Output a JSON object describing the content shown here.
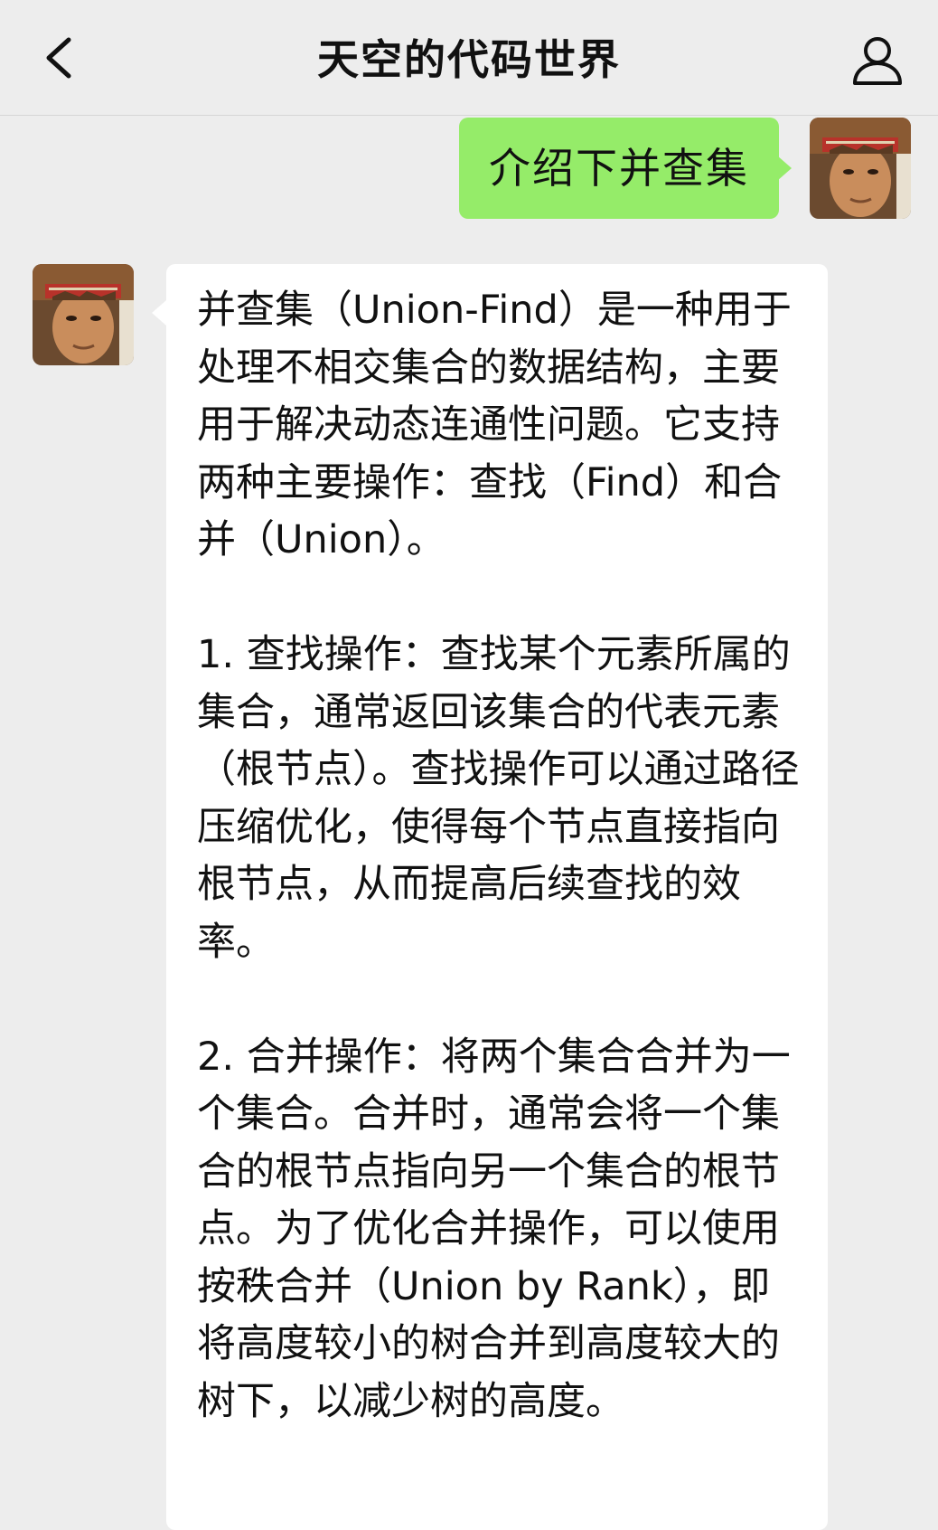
{
  "header": {
    "title": "天空的代码世界",
    "back_icon": "chevron-left-icon",
    "profile_icon": "person-icon"
  },
  "messages": [
    {
      "sender": "me",
      "text": "介绍下并查集"
    },
    {
      "sender": "other",
      "paragraphs": [
        "并查集（Union-Find）是一种用于处理不相交集合的数据结构，主要用于解决动态连通性问题。它支持两种主要操作：查找（Find）和合并（Union）。",
        "1. 查找操作：查找某个元素所属的集合，通常返回该集合的代表元素（根节点）。查找操作可以通过路径压缩优化，使得每个节点直接指向根节点，从而提高后续查找的效率。",
        "2. 合并操作：将两个集合合并为一个集合。合并时，通常会将一个集合的根节点指向另一个集合的根节点。为了优化合并操作，可以使用按秩合并（Union by Rank），即将高度较小的树合并到高度较大的树下，以减少树的高度。"
      ]
    }
  ],
  "colors": {
    "background": "#ededed",
    "outgoing_bubble": "#95ec69",
    "incoming_bubble": "#ffffff",
    "text": "#111111"
  }
}
